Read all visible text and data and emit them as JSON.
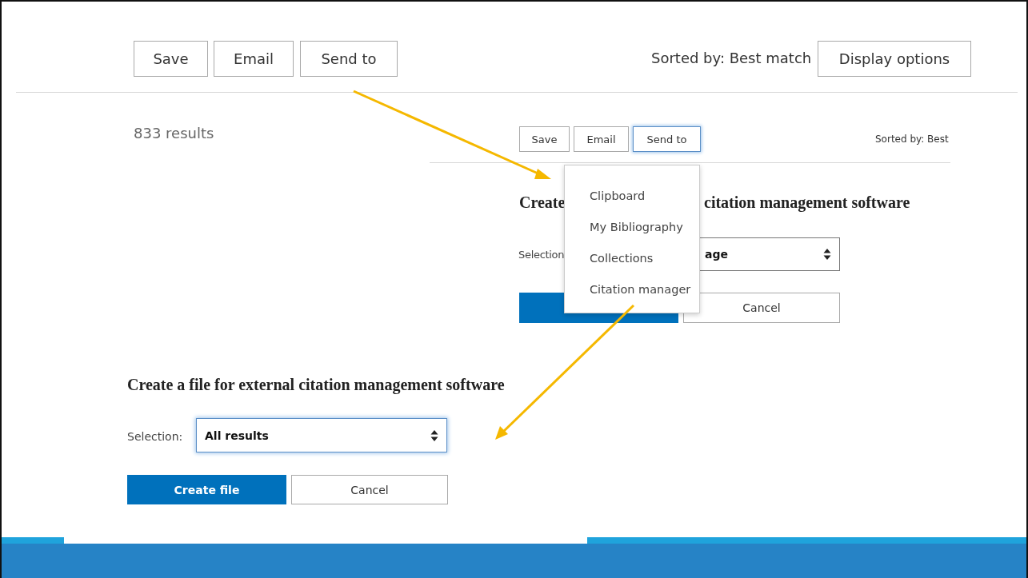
{
  "toolbar": {
    "buttons": [
      {
        "label": "Save",
        "focused": false
      },
      {
        "label": "Email",
        "focused": false
      },
      {
        "label": "Send to",
        "focused": false
      }
    ],
    "sort_label": "Sorted by: Best match",
    "display_button": "Display options"
  },
  "results_count": "833 results",
  "inset": {
    "buttons": [
      {
        "label": "Save",
        "focused": false
      },
      {
        "label": "Email",
        "focused": false
      },
      {
        "label": "Send to",
        "focused": true
      }
    ],
    "sort_label": "Sorted by: Best",
    "heading_parts": [
      "Create",
      "citation management software"
    ],
    "selection_label": "Selection",
    "select_value": "age",
    "cancel": "Cancel"
  },
  "send_to_menu": {
    "items": [
      "Clipboard",
      "My Bibliography",
      "Collections",
      "Citation manager"
    ]
  },
  "citation_form": {
    "heading": "Create a file for external citation management software",
    "selection_label": "Selection:",
    "select_value": "All results",
    "select_focused": true,
    "create_button": "Create file",
    "cancel_button": "Cancel"
  }
}
